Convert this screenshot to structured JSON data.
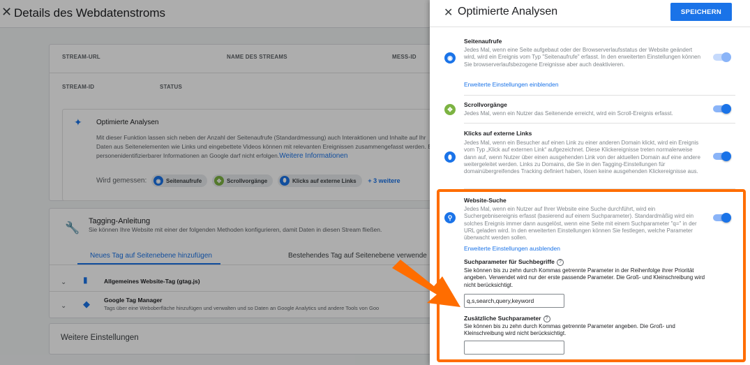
{
  "background": {
    "title": "Details des Webdatenstroms",
    "stream_labels": {
      "url": "STREAM-URL",
      "name": "NAME DES STREAMS",
      "mess_id": "MESS-ID",
      "stream_id": "STREAM-ID",
      "status": "STATUS"
    },
    "enhanced": {
      "title": "Optimierte Analysen",
      "desc_line1": "Mit dieser Funktion lassen sich neben der Anzahl der Seitenaufrufe (Standardmessung) auch Interaktionen und Inhalte auf Ihr",
      "desc_line2": "Daten aus Seitenelementen wie Links und eingebettete Videos können mit relevanten Ereignissen zusammengefasst werden. E",
      "desc_line3": "personenidentifizierbarer Informationen an Google darf nicht erfolgen.",
      "more_info_link": "Weitere Informationen",
      "measured_label": "Wird gemessen:",
      "chips": [
        "Seitenaufrufe",
        "Scrollvorgänge",
        "Klicks auf externe Links"
      ],
      "more_link": "+ 3 weitere"
    },
    "tagging": {
      "title": "Tagging-Anleitung",
      "subtitle": "Sie können Ihre Website mit einer der folgenden Methoden konfigurieren, damit Daten in diesen Stream fließen.",
      "tab_new": "Neues Tag auf Seitenebene hinzufügen",
      "tab_existing": "Bestehendes Tag auf Seitenebene verwende",
      "row1_title": "Allgemeines Website-Tag (gtag.js)",
      "row2_title": "Google Tag Manager",
      "row2_sub": "Tags über eine Weboberfläche hinzufügen und verwalten und so Daten an Google Analytics und andere Tools von Goo"
    },
    "more_settings": "Weitere Einstellungen"
  },
  "panel": {
    "title": "Optimierte Analysen",
    "save_label": "SPEICHERN",
    "sections": [
      {
        "title": "Seitenaufrufe",
        "desc": "Jedes Mal, wenn eine Seite aufgebaut oder der Browserverlaufsstatus der Website geändert wird, wird ein Ereignis vom Typ \"Seitenaufrufe\" erfasst. In den erweiterten Einstellungen können Sie browserverlaufsbezogene Ereignisse aber auch deaktivieren.",
        "link": "Erweiterte Einstellungen einblenden",
        "icon": "eye-icon",
        "color": "#1a73e8",
        "enabled": true,
        "toggle_disabled": true
      },
      {
        "title": "Scrollvorgänge",
        "desc": "Jedes Mal, wenn ein Nutzer das Seitenende erreicht, wird ein Scroll-Ereignis erfasst.",
        "icon": "crosshair-icon",
        "color": "#7cb342",
        "enabled": true
      },
      {
        "title": "Klicks auf externe Links",
        "desc": "Jedes Mal, wenn ein Besucher auf einen Link zu einer anderen Domain klickt, wird ein Ereignis vom Typ „Klick auf externen Link“ aufgezeichnet. Diese Klickereignisse treten normalerweise dann auf, wenn Nutzer über einen ausgehenden Link von der aktuellen Domain auf eine andere weitergeleitet werden. Links zu Domains, die Sie in den Tagging-Einstellungen für domainübergreifendes Tracking definiert haben, lösen keine ausgehenden Klickereignisse aus.",
        "icon": "mouse-icon",
        "color": "#1a73e8",
        "enabled": true
      },
      {
        "title": "Website-Suche",
        "desc": "Jedes Mal, wenn ein Nutzer auf Ihrer Website eine Suche durchführt, wird ein Suchergebnisereignis erfasst (basierend auf einem Suchparameter). Standardmäßig wird ein solches Ereignis immer dann ausgelöst, wenn eine Seite mit einem Suchparameter \"q=\" in der URL geladen wird. In den erweiterten Einstellungen können Sie festlegen, welche Parameter überwacht werden sollen.",
        "link": "Erweiterte Einstellungen ausblenden",
        "icon": "search-icon",
        "color": "#1a73e8",
        "enabled": true
      }
    ],
    "search_params": {
      "title": "Suchparameter für Suchbegriffe",
      "desc": "Sie können bis zu zehn durch Kommas getrennte Parameter in der Reihenfolge ihrer Priorität angeben. Verwendet wird nur der erste passende Parameter. Die Groß- und Kleinschreibung wird nicht berücksichtigt.",
      "value": "q,s,search,query,keyword"
    },
    "extra_params": {
      "title": "Zusätzliche Suchparameter",
      "desc": "Sie können bis zu zehn durch Kommas getrennte Parameter angeben. Die Groß- und Kleinschreibung wird nicht berücksichtigt.",
      "value": ""
    }
  },
  "highlight_color": "#ff6d00"
}
